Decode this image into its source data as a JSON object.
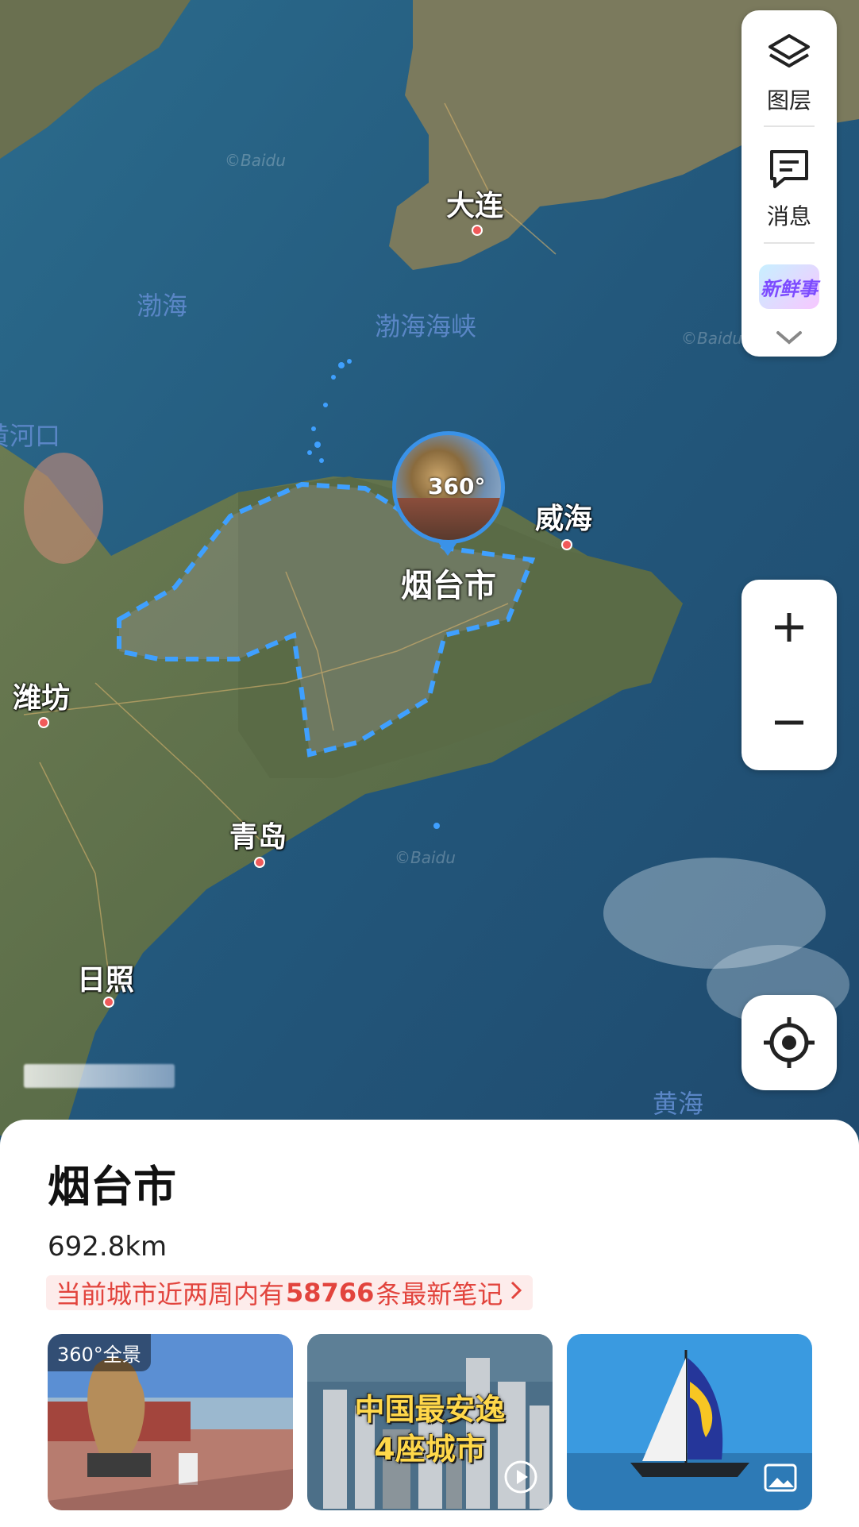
{
  "map": {
    "places": [
      {
        "id": "dalian",
        "label": "大连"
      },
      {
        "id": "weihai",
        "label": "威海"
      },
      {
        "id": "weifang",
        "label": "潍坊"
      },
      {
        "id": "qingdao",
        "label": "青岛"
      },
      {
        "id": "rizhao",
        "label": "日照"
      }
    ],
    "water": {
      "bohai": "渤海",
      "bohai_strait": "渤海海峡",
      "yellow_sea": "黄海",
      "river_mouth": "黄河口"
    },
    "watermark": "©Baidu",
    "selected_city": "烟台市",
    "pano_label": "360°"
  },
  "toolbar": {
    "layers_label": "图层",
    "messages_label": "消息",
    "xinxianshi_label": "新鲜事"
  },
  "sheet": {
    "title": "烟台市",
    "distance": "692.8km",
    "notes_prefix": "当前城市近两周内有",
    "notes_count": "58766",
    "notes_suffix": "条最新笔记",
    "thumbs": [
      {
        "tag": "360°全景"
      },
      {
        "headline_1": "中国最安逸",
        "headline_2": "4座城市"
      },
      {}
    ]
  },
  "colors": {
    "accent_blue": "#3a92e8",
    "note_red": "#e2443d",
    "boundary_dash": "#3fa0ff"
  }
}
